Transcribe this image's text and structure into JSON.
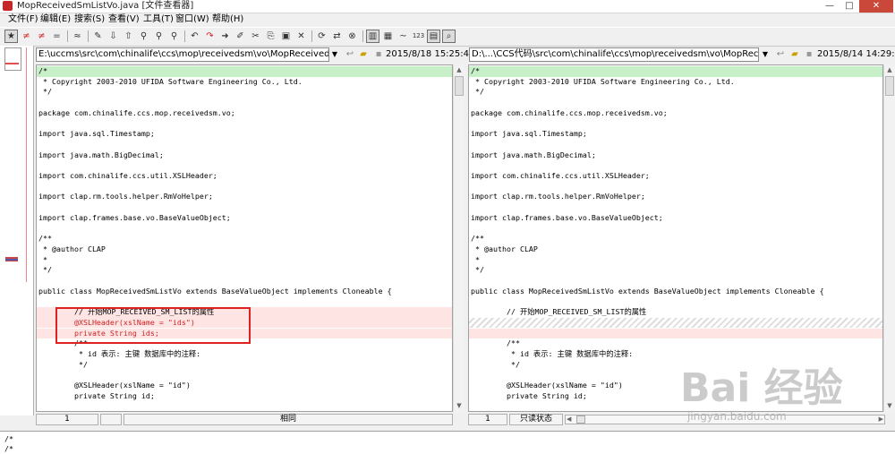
{
  "window": {
    "title": "MopReceivedSmListVo.java  [文件查看器]",
    "controls": [
      "—",
      "□",
      "✕"
    ]
  },
  "menu": [
    "文件(F)",
    "编辑(E)",
    "搜索(S)",
    "查看(V)",
    "工具(T)",
    "窗口(W)",
    "帮助(H)"
  ],
  "toolbar": [
    {
      "icon": "star-filter-icon",
      "glyph": "★",
      "pressed": true
    },
    {
      "icon": "diff-red-icon",
      "glyph": "≠"
    },
    {
      "icon": "diff-red-box-icon",
      "glyph": "≠"
    },
    {
      "icon": "equal-icon",
      "glyph": "="
    },
    {
      "sep": true
    },
    {
      "icon": "approx-icon",
      "glyph": "≈"
    },
    {
      "sep": true
    },
    {
      "icon": "rules-icon",
      "glyph": "✎"
    },
    {
      "icon": "down-arrow-icon",
      "glyph": "⇩"
    },
    {
      "icon": "up-arrow-icon",
      "glyph": "⇧"
    },
    {
      "icon": "binoculars-icon",
      "glyph": "⚲"
    },
    {
      "icon": "binoculars-next-icon",
      "glyph": "⚲"
    },
    {
      "icon": "binoculars-prev-icon",
      "glyph": "⚲"
    },
    {
      "sep": true
    },
    {
      "icon": "undo-icon",
      "glyph": "↶"
    },
    {
      "icon": "redo-icon",
      "glyph": "↷"
    },
    {
      "icon": "goto-icon",
      "glyph": "➜"
    },
    {
      "icon": "edit-icon",
      "glyph": "✐"
    },
    {
      "icon": "cut-icon",
      "glyph": "✂"
    },
    {
      "icon": "copy-icon",
      "glyph": "⎘"
    },
    {
      "icon": "paste-icon",
      "glyph": "▣"
    },
    {
      "icon": "delete-icon",
      "glyph": "✕"
    },
    {
      "sep": true
    },
    {
      "icon": "refresh-icon",
      "glyph": "⟳"
    },
    {
      "icon": "swap-icon",
      "glyph": "⇄"
    },
    {
      "icon": "stop-icon",
      "glyph": "⊗"
    },
    {
      "sep": true
    },
    {
      "icon": "layout-icon",
      "glyph": "▥",
      "pressed": true
    },
    {
      "icon": "columns-icon",
      "glyph": "▦"
    },
    {
      "icon": "tilde-icon",
      "glyph": "~"
    },
    {
      "icon": "line-numbers-icon",
      "glyph": "123"
    },
    {
      "icon": "window-icon",
      "glyph": "▤",
      "pressed": true
    },
    {
      "icon": "zoom-icon",
      "glyph": "⌕",
      "pressed": true
    }
  ],
  "left": {
    "path": "E:\\uccms\\src\\com\\chinalife\\ccs\\mop\\receivedsm\\vo\\MopReceivedSmListVo.j",
    "date": "2015/8/18 15:25:48",
    "status_line": "1",
    "status_msg": "相同"
  },
  "right": {
    "path": "D:\\...\\CCS代码\\src\\com\\chinalife\\ccs\\mop\\receivedsm\\vo\\MopReceivedSmLi",
    "date": "2015/8/14 14:29:57",
    "status_line": "1",
    "status_msg": "只读状态"
  },
  "colors": {
    "changed_bg": "#ffe4e4",
    "changed_text": "#cc2222",
    "first_line_bg": "#c8f0c8",
    "comment_text": "#000000"
  },
  "code_left": [
    {
      "t": "/*",
      "k": "first"
    },
    {
      "t": " * Copyright 2003-2010 UFIDA Software Engineering Co., Ltd."
    },
    {
      "t": " */"
    },
    {
      "t": ""
    },
    {
      "t": "package com.chinalife.ccs.mop.receivedsm.vo;"
    },
    {
      "t": ""
    },
    {
      "t": "import java.sql.Timestamp;"
    },
    {
      "t": ""
    },
    {
      "t": "import java.math.BigDecimal;"
    },
    {
      "t": ""
    },
    {
      "t": "import com.chinalife.ccs.util.XSLHeader;"
    },
    {
      "t": ""
    },
    {
      "t": "import clap.rm.tools.helper.RmVoHelper;"
    },
    {
      "t": ""
    },
    {
      "t": "import clap.frames.base.vo.BaseValueObject;"
    },
    {
      "t": ""
    },
    {
      "t": "/**"
    },
    {
      "t": " * @author CLAP"
    },
    {
      "t": " *"
    },
    {
      "t": " */"
    },
    {
      "t": ""
    },
    {
      "t": "public class MopReceivedSmListVo extends BaseValueObject implements Cloneable {"
    },
    {
      "t": ""
    },
    {
      "t": "        // 开始MOP_RECEIVED_SM_LIST的属性",
      "k": "changed-plain"
    },
    {
      "t": "        @XSLHeader(xslName = \"ids\")",
      "k": "changed"
    },
    {
      "t": "        private String ids;",
      "k": "changed"
    },
    {
      "t": "        /**"
    },
    {
      "t": "         * id 表示: 主键 数据库中的注释:"
    },
    {
      "t": "         */"
    },
    {
      "t": ""
    },
    {
      "t": "        @XSLHeader(xslName = \"id\")"
    },
    {
      "t": "        private String id;"
    }
  ],
  "code_right": [
    {
      "t": "/*",
      "k": "first"
    },
    {
      "t": " * Copyright 2003-2010 UFIDA Software Engineering Co., Ltd."
    },
    {
      "t": " */"
    },
    {
      "t": ""
    },
    {
      "t": "package com.chinalife.ccs.mop.receivedsm.vo;"
    },
    {
      "t": ""
    },
    {
      "t": "import java.sql.Timestamp;"
    },
    {
      "t": ""
    },
    {
      "t": "import java.math.BigDecimal;"
    },
    {
      "t": ""
    },
    {
      "t": "import com.chinalife.ccs.util.XSLHeader;"
    },
    {
      "t": ""
    },
    {
      "t": "import clap.rm.tools.helper.RmVoHelper;"
    },
    {
      "t": ""
    },
    {
      "t": "import clap.frames.base.vo.BaseValueObject;"
    },
    {
      "t": ""
    },
    {
      "t": "/**"
    },
    {
      "t": " * @author CLAP"
    },
    {
      "t": " *"
    },
    {
      "t": " */"
    },
    {
      "t": ""
    },
    {
      "t": "public class MopReceivedSmListVo extends BaseValueObject implements Cloneable {"
    },
    {
      "t": ""
    },
    {
      "t": "        // 开始MOP_RECEIVED_SM_LIST的属性"
    },
    {
      "t": "",
      "k": "missing"
    },
    {
      "t": "",
      "k": "missing-pink"
    },
    {
      "t": "        /**"
    },
    {
      "t": "         * id 表示: 主键 数据库中的注释:"
    },
    {
      "t": "         */"
    },
    {
      "t": ""
    },
    {
      "t": "        @XSLHeader(xslName = \"id\")"
    },
    {
      "t": "        private String id;"
    }
  ],
  "bottom_lines": [
    "/*",
    "/*"
  ],
  "watermark": {
    "brand": "Bai 经验",
    "url": "jingyan.baidu.com"
  }
}
